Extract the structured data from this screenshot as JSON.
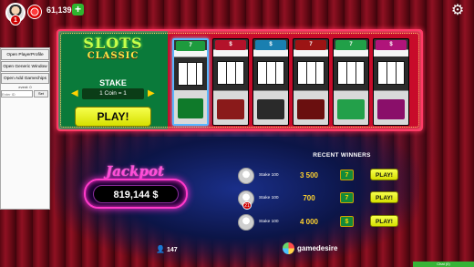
{
  "topbar": {
    "level": "1",
    "coins": "61,139",
    "add_label": "+",
    "settings_icon": "gear-icon"
  },
  "debug": {
    "buttons": [
      "Open PlayerProfile",
      "Open Generic Window",
      "Open Add Gamechips"
    ],
    "label": "event: 0",
    "input_placeholder": "Enter ID",
    "set_label": "Set"
  },
  "game": {
    "logo_top": "SLOTS",
    "logo_bottom": "CLASSIC",
    "stake_title": "STAKE",
    "stake_value": "1 Coin = 1",
    "play_label": "PLAY!",
    "machines": [
      {
        "sign": "7",
        "sign_color": "#1e9b3e",
        "base_color": "#0f7a2a"
      },
      {
        "sign": "$",
        "sign_color": "#b3122a",
        "base_color": "#8a1a1a"
      },
      {
        "sign": "$",
        "sign_color": "#1a7fb0",
        "base_color": "#2a2a2a"
      },
      {
        "sign": "7",
        "sign_color": "#9c1414",
        "base_color": "#6a0f0f"
      },
      {
        "sign": "7",
        "sign_color": "#21a048",
        "base_color": "#23a04a"
      },
      {
        "sign": "$",
        "sign_color": "#b0147a",
        "base_color": "#8a0f6a"
      }
    ]
  },
  "jackpot": {
    "title": "Jackpot",
    "value": "819,144 $"
  },
  "players": {
    "count": "147"
  },
  "recent_winners": {
    "title": "RECENT WINNERS",
    "rows": [
      {
        "level": "",
        "stake": "Stake 100",
        "amount": "3 500",
        "symbol": "7",
        "play": "PLAY!"
      },
      {
        "level": "21",
        "stake": "Stake 100",
        "amount": "700",
        "symbol": "7",
        "play": "PLAY!"
      },
      {
        "level": "",
        "stake": "Stake 100",
        "amount": "4 000",
        "symbol": "$",
        "play": "PLAY!"
      }
    ]
  },
  "brand": {
    "name": "gamedesire"
  },
  "chat": {
    "label": "Chat (0)"
  }
}
